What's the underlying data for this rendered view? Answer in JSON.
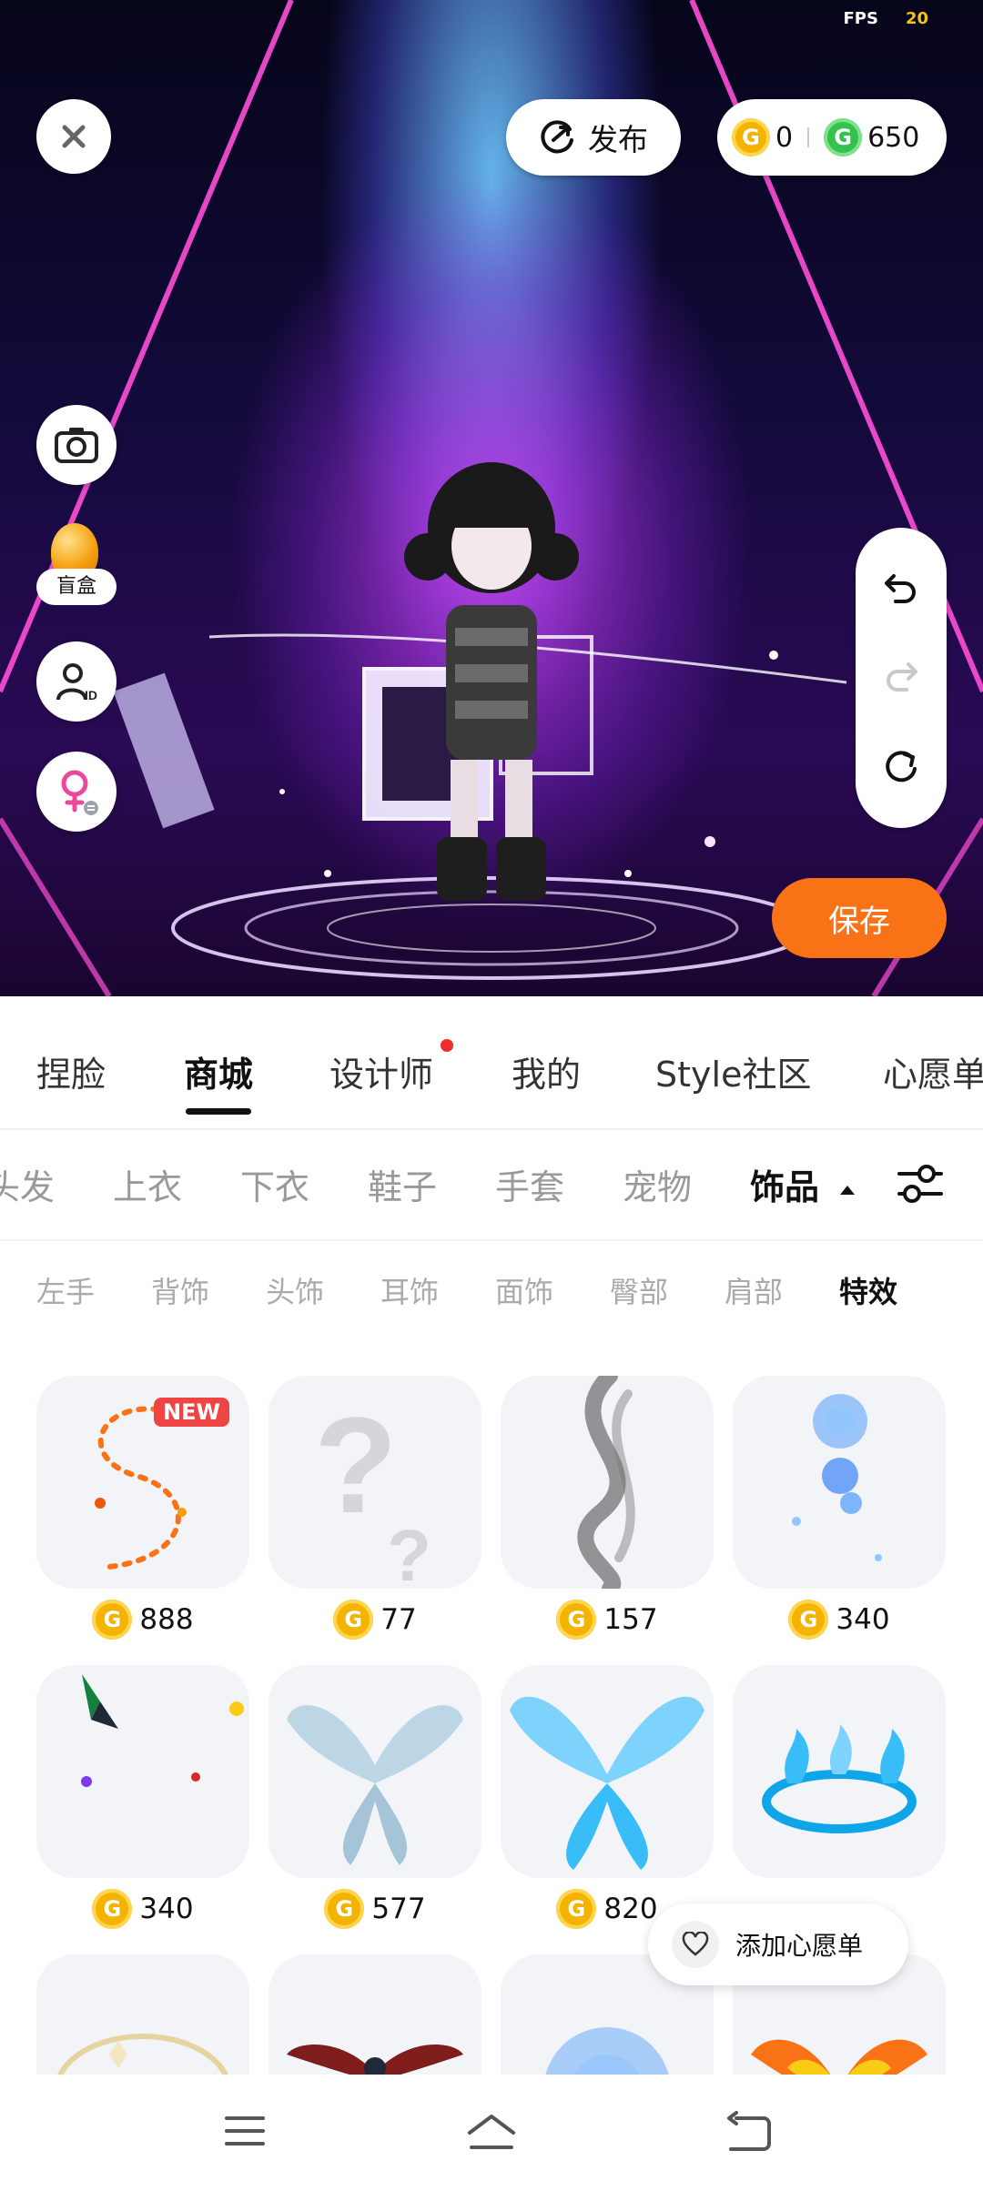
{
  "status": {
    "fps_label": "FPS",
    "fps_value": "20"
  },
  "topbar": {
    "publish_label": "发布",
    "gold_coin_value": "0",
    "green_coin_value": "650",
    "coin_glyph": "G"
  },
  "left_tools": {
    "blind_box_label": "盲盒"
  },
  "save_label": "保存",
  "tabs": [
    {
      "label": "捏脸"
    },
    {
      "label": "商城",
      "active": true
    },
    {
      "label": "设计师",
      "dot": true
    },
    {
      "label": "我的"
    },
    {
      "label": "Style社区"
    },
    {
      "label": "心愿单"
    }
  ],
  "categories": [
    {
      "label": "头发"
    },
    {
      "label": "上衣"
    },
    {
      "label": "下衣"
    },
    {
      "label": "鞋子"
    },
    {
      "label": "手套"
    },
    {
      "label": "宠物"
    },
    {
      "label": "饰品",
      "active": true
    }
  ],
  "subcategories": [
    {
      "label": "左手"
    },
    {
      "label": "背饰"
    },
    {
      "label": "头饰"
    },
    {
      "label": "耳饰"
    },
    {
      "label": "面饰"
    },
    {
      "label": "臀部"
    },
    {
      "label": "肩部"
    },
    {
      "label": "特效",
      "active": true
    }
  ],
  "items": [
    {
      "price": "888",
      "badge": "NEW",
      "icon": "swirl-trail-effect"
    },
    {
      "price": "77",
      "icon": "question-mark-placeholder"
    },
    {
      "price": "157",
      "icon": "smoke-effect"
    },
    {
      "price": "340",
      "icon": "blue-orb-effect"
    },
    {
      "price": "340",
      "icon": "butterfly-effect"
    },
    {
      "price": "577",
      "icon": "ice-wings-effect"
    },
    {
      "price": "820",
      "icon": "crystal-wings-effect"
    },
    {
      "price": "",
      "icon": "blue-flame-circle-effect"
    },
    {
      "price": "",
      "icon": "golden-halo-effect"
    },
    {
      "price": "",
      "icon": "dark-wings-effect"
    },
    {
      "price": "",
      "icon": "blue-aura-effect"
    },
    {
      "price": "",
      "icon": "fire-wings-effect"
    }
  ],
  "wishlist_label": "添加心愿单",
  "colors": {
    "accent": "#f97316",
    "gold": "#f5b301",
    "green": "#32c24d",
    "badge": "#ef4444"
  }
}
